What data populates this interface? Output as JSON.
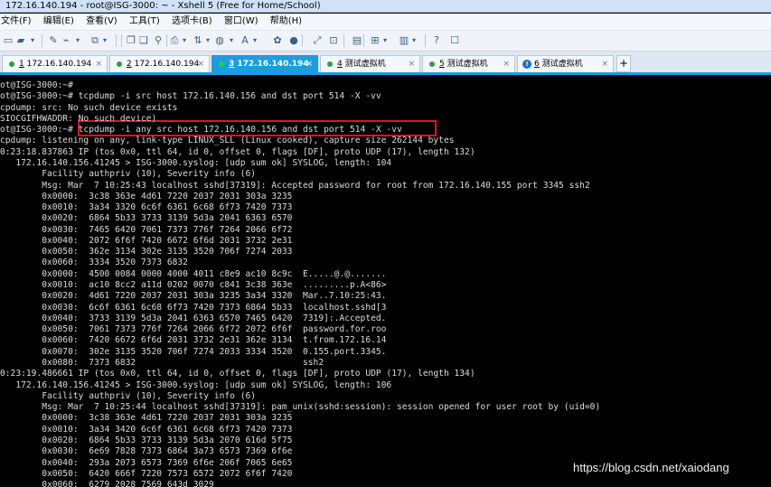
{
  "window": {
    "title": "172.16.140.194 - root@ISG-3000: ~ - Xshell 5 (Free for Home/School)"
  },
  "menu": [
    "文件(F)",
    "编辑(E)",
    "查看(V)",
    "工具(T)",
    "选项卡(B)",
    "窗口(W)",
    "帮助(H)"
  ],
  "toolbar_icons": [
    "new-session-icon",
    "open-folder-icon",
    "dropdown-icon",
    "properties-icon",
    "disconnect-icon",
    "dropdown-icon",
    "new-tab-icon",
    "dropdown-icon",
    "copy-icon",
    "paste-icon",
    "find-icon",
    "print-icon",
    "dropdown-icon",
    "transfer-icon",
    "dropdown-icon",
    "globe-icon",
    "dropdown-icon",
    "font-icon",
    "dropdown-icon",
    "script-icon",
    "record-icon",
    "fullscreen-icon",
    "lock-icon",
    "keyboard-icon",
    "compose-icon",
    "dropdown-icon",
    "layout-icon",
    "dropdown-icon",
    "help-icon",
    "chat-icon"
  ],
  "tabs": [
    {
      "num": "1",
      "label": "172.16.140.194",
      "active": false,
      "icon": "status-dot"
    },
    {
      "num": "2",
      "label": "172.16.140.194",
      "active": false,
      "icon": "status-dot"
    },
    {
      "num": "3",
      "label": "172.16.140.194",
      "active": true,
      "icon": "status-dot"
    },
    {
      "num": "4",
      "label": "测试虚拟机",
      "active": false,
      "icon": "status-dot"
    },
    {
      "num": "5",
      "label": "测试虚拟机",
      "active": false,
      "icon": "status-dot"
    },
    {
      "num": "6",
      "label": "测试虚拟机",
      "active": false,
      "icon": "info-icon"
    }
  ],
  "tab_add_label": "+",
  "tab_close_label": "×",
  "terminal_lines": [
    "ot@ISG-3000:~#",
    "ot@ISG-3000:~# tcpdump -i src host 172.16.140.156 and dst port 514 -X -vv",
    "cpdump: src: No such device exists",
    "SIOCGIFHWADDR: No such device)",
    "ot@ISG-3000:~# tcpdump -i any src host 172.16.140.156 and dst port 514 -X -vv",
    "cpdump: listening on any, link-type LINUX_SLL (Linux cooked), capture size 262144 bytes",
    "0:23:18.837863 IP (tos 0x0, ttl 64, id 0, offset 0, flags [DF], proto UDP (17), length 132)",
    "   172.16.140.156.41245 > ISG-3000.syslog: [udp sum ok] SYSLOG, length: 104",
    "        Facility authpriv (10), Severity info (6)",
    "        Msg: Mar  7 10:25:43 localhost sshd[37319]: Accepted password for root from 172.16.140.155 port 3345 ssh2",
    "        0x0000:  3c38 363e 4d61 7220 2037 2031 303a 3235",
    "        0x0010:  3a34 3320 6c6f 6361 6c68 6f73 7420 7373",
    "        0x0020:  6864 5b33 3733 3139 5d3a 2041 6363 6570",
    "        0x0030:  7465 6420 7061 7373 776f 7264 2066 6f72",
    "        0x0040:  2072 6f6f 7420 6672 6f6d 2031 3732 2e31",
    "        0x0050:  362e 3134 302e 3135 3520 706f 7274 2033",
    "        0x0060:  3334 3520 7373 6832",
    "        0x0000:  4500 0084 0000 4000 4011 c8e9 ac10 8c9c  E.....@.@.......",
    "        0x0010:  ac10 8cc2 a11d 0202 0070 c841 3c38 363e  .........p.A<86>",
    "        0x0020:  4d61 7220 2037 2031 303a 3235 3a34 3320  Mar..7.10:25:43.",
    "        0x0030:  6c6f 6361 6c68 6f73 7420 7373 6864 5b33  localhost.sshd[3",
    "        0x0040:  3733 3139 5d3a 2041 6363 6570 7465 6420  7319]:.Accepted.",
    "        0x0050:  7061 7373 776f 7264 2066 6f72 2072 6f6f  password.for.roo",
    "        0x0060:  7420 6672 6f6d 2031 3732 2e31 362e 3134  t.from.172.16.14",
    "        0x0070:  302e 3135 3520 706f 7274 2033 3334 3520  0.155.port.3345.",
    "        0x0080:  7373 6832                                ssh2",
    "0:23:19.486661 IP (tos 0x0, ttl 64, id 0, offset 0, flags [DF], proto UDP (17), length 134)",
    "   172.16.140.156.41245 > ISG-3000.syslog: [udp sum ok] SYSLOG, length: 106",
    "        Facility authpriv (10), Severity info (6)",
    "        Msg: Mar  7 10:25:44 localhost sshd[37319]: pam_unix(sshd:session): session opened for user root by (uid=0)",
    "        0x0000:  3c38 363e 4d61 7220 2037 2031 303a 3235",
    "        0x0010:  3a34 3420 6c6f 6361 6c68 6f73 7420 7373",
    "        0x0020:  6864 5b33 3733 3139 5d3a 2070 616d 5f75",
    "        0x0030:  6e69 7828 7373 6864 3a73 6573 7369 6f6e",
    "        0x0040:  293a 2073 6573 7369 6f6e 206f 7065 6e65",
    "        0x0050:  6420 666f 7220 7573 6572 2072 6f6f 7420",
    "        0x0060:  6279 2028 7569 643d 3029"
  ],
  "watermark": "https://blog.csdn.net/xaiodang"
}
